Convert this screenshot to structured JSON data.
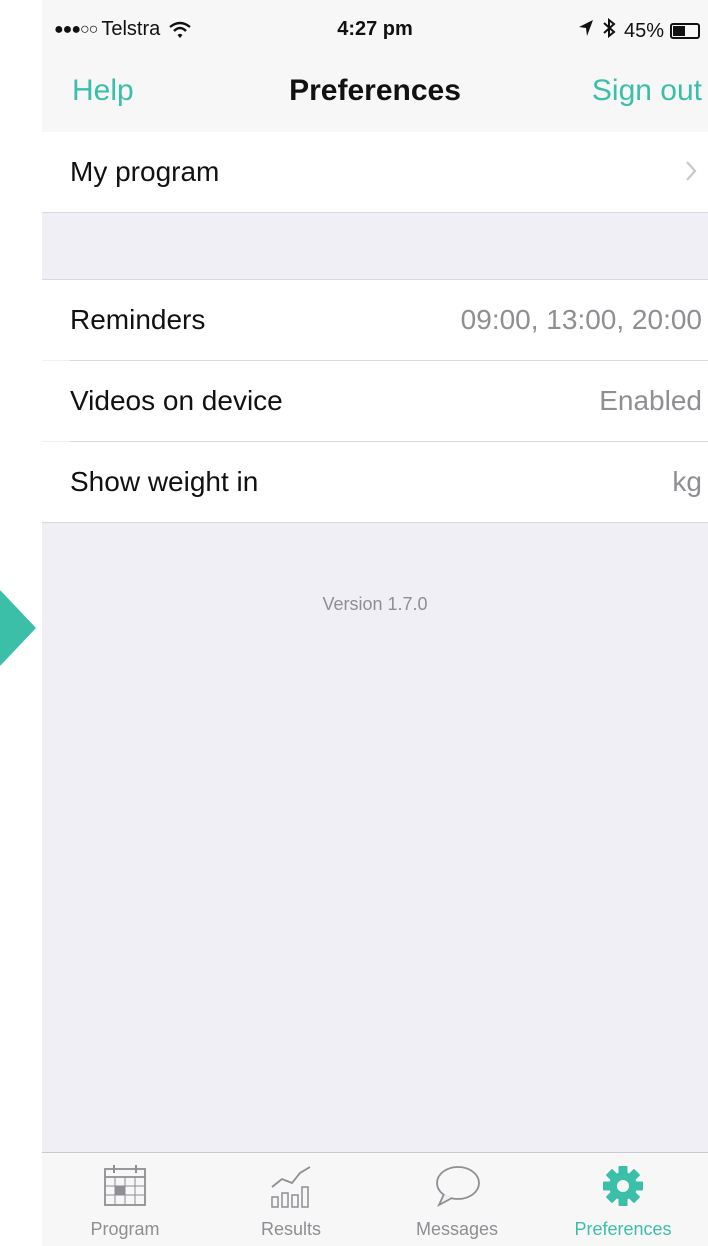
{
  "status_bar": {
    "signal": "●●●○○",
    "carrier": "Telstra",
    "time": "4:27 pm",
    "battery": "45%"
  },
  "nav": {
    "left": "Help",
    "title": "Preferences",
    "right": "Sign out"
  },
  "rows": {
    "my_program": {
      "label": "My program"
    },
    "reminders": {
      "label": "Reminders",
      "value": "09:00, 13:00, 20:00"
    },
    "videos": {
      "label": "Videos on device",
      "value": "Enabled"
    },
    "weight": {
      "label": "Show weight in",
      "value": "kg"
    }
  },
  "version": "Version 1.7.0",
  "tabs": [
    {
      "label": "Program",
      "icon": "calendar-icon",
      "active": false
    },
    {
      "label": "Results",
      "icon": "chart-icon",
      "active": false
    },
    {
      "label": "Messages",
      "icon": "speech-bubble-icon",
      "active": false
    },
    {
      "label": "Preferences",
      "icon": "gear-icon",
      "active": true
    }
  ],
  "colors": {
    "accent": "#3bbfa9",
    "background": "#efeff5",
    "secondary_text": "#8e8e93"
  }
}
